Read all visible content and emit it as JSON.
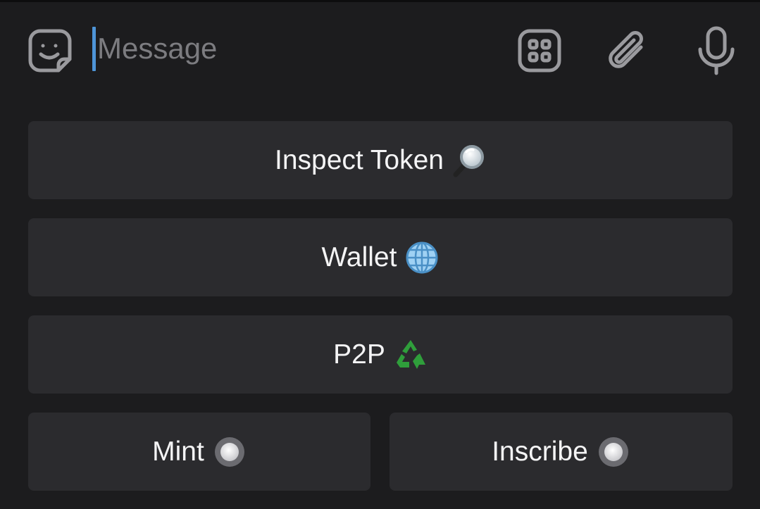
{
  "composer": {
    "placeholder": "Message",
    "value": "",
    "icons": {
      "sticker": "sticker-icon",
      "commands": "bot-commands-icon",
      "attach": "paperclip-icon",
      "mic": "microphone-icon"
    },
    "caret_color": "#4e95d8"
  },
  "keyboard": {
    "buttons": [
      {
        "label": "Inspect Token",
        "emoji": "magnifying-glass-icon"
      },
      {
        "label": "Wallet",
        "emoji": "globe-icon"
      },
      {
        "label": "P2P",
        "emoji": "recycle-icon"
      },
      {
        "label": "Mint",
        "emoji": "radio-button-icon"
      },
      {
        "label": "Inscribe",
        "emoji": "radio-button-icon"
      }
    ]
  },
  "colors": {
    "background": "#1c1c1e",
    "button": "#2b2b2e",
    "text": "#f4f4f5",
    "icon": "#9a9a9e",
    "placeholder": "#7c7c80"
  }
}
